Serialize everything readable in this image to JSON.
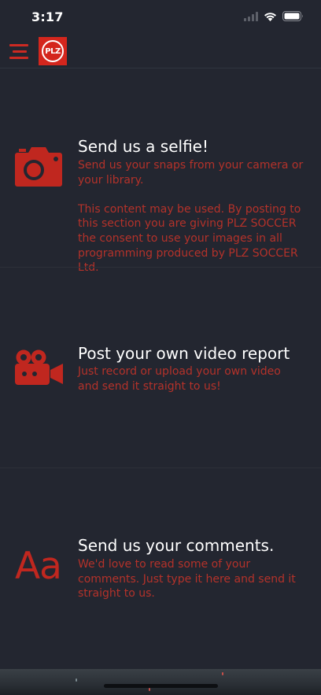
{
  "status_bar": {
    "time": "3:17",
    "icons": [
      "cellular-signal-icon",
      "wifi-icon",
      "battery-icon"
    ]
  },
  "header": {
    "menu_icon": "menu-icon",
    "logo_text": "PLZ"
  },
  "sections": [
    {
      "icon": "camera-icon",
      "title": "Send us a selfie!",
      "description_lines": [
        "Send us your snaps from your camera or",
        "your library.",
        "",
        "This content may be used. By posting to",
        "this section you are giving PLZ SOCCER",
        "the consent to use your images in all",
        "programming produced by PLZ SOCCER",
        "Ltd."
      ]
    },
    {
      "icon": "video-camera-icon",
      "title": "Post your own video report",
      "description_lines": [
        "Just record or upload your own video",
        "and send it straight to us!"
      ]
    },
    {
      "icon": "text-aa-icon",
      "icon_text": "Aa",
      "title": "Send us your comments.",
      "description_lines": [
        "We'd love to read some of your",
        "comments. Just type it here and send it",
        "straight to us."
      ]
    }
  ],
  "colors": {
    "background": "#232630",
    "accent": "#c0271f",
    "title_text": "#ffffff",
    "description_text": "#b4322a"
  }
}
